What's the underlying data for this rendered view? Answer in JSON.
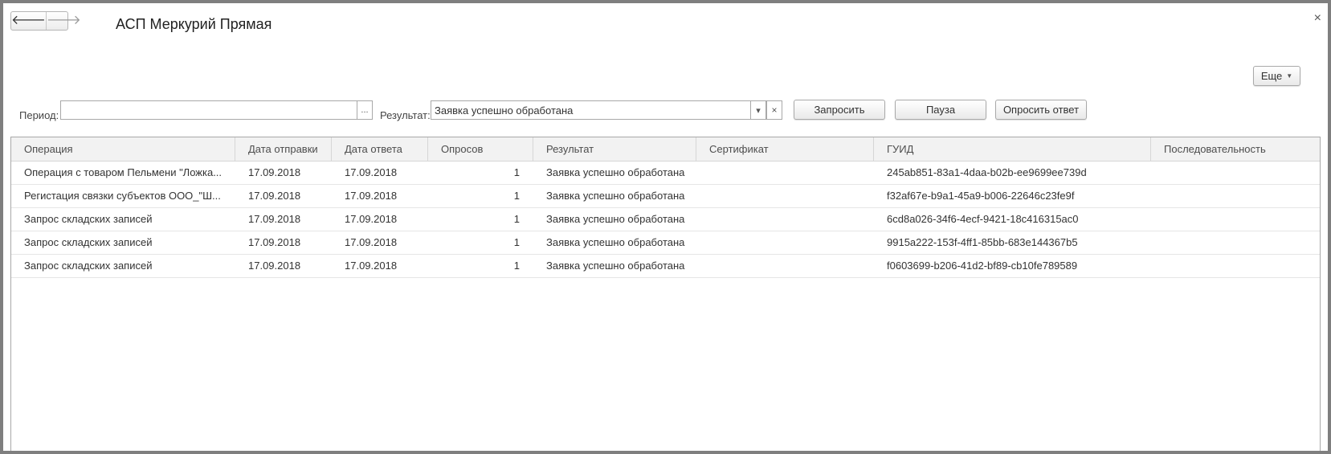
{
  "window": {
    "title": "АСП Меркурий Прямая",
    "nav_back_glyph": "🡐",
    "nav_forward_glyph": "🡒",
    "close_glyph": "×"
  },
  "toolbar": {
    "more_label": "Еще",
    "period_label": "Период:",
    "period_value": "",
    "period_select_glyph": "...",
    "result_label": "Результат:",
    "result_value": "Заявка успешно обработана",
    "result_dropdown_glyph": "▾",
    "result_clear_glyph": "×",
    "request_label": "Запросить",
    "pause_label": "Пауза",
    "poll_label": "Опросить ответ"
  },
  "table": {
    "headers": [
      "Операция",
      "Дата отправки",
      "Дата ответа",
      "Опросов",
      "Результат",
      "Сертификат",
      "ГУИД",
      "Последовательность"
    ],
    "rows": [
      [
        "Операция с товаром Пельмени \"Ложка...",
        "17.09.2018",
        "17.09.2018",
        "1",
        "Заявка успешно обработана",
        "",
        "245ab851-83a1-4daa-b02b-ee9699ee739d",
        ""
      ],
      [
        "Регистация связки субъектов ООО_\"Ш...",
        "17.09.2018",
        "17.09.2018",
        "1",
        "Заявка успешно обработана",
        "",
        "f32af67e-b9a1-45a9-b006-22646c23fe9f",
        ""
      ],
      [
        "Запрос складских записей",
        "17.09.2018",
        "17.09.2018",
        "1",
        "Заявка успешно обработана",
        "",
        "6cd8a026-34f6-4ecf-9421-18c416315ac0",
        ""
      ],
      [
        "Запрос складских записей",
        "17.09.2018",
        "17.09.2018",
        "1",
        "Заявка успешно обработана",
        "",
        "9915a222-153f-4ff1-85bb-683e144367b5",
        ""
      ],
      [
        "Запрос складских записей",
        "17.09.2018",
        "17.09.2018",
        "1",
        "Заявка успешно обработана",
        "",
        "f0603699-b206-41d2-bf89-cb10fe789589",
        ""
      ]
    ]
  }
}
